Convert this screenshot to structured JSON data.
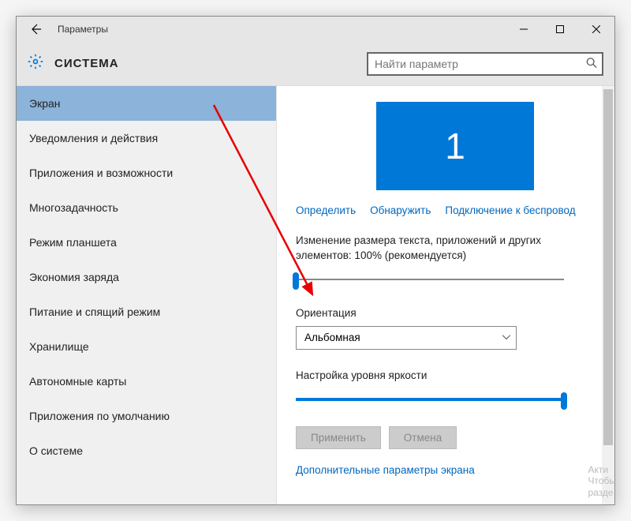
{
  "window": {
    "title": "Параметры"
  },
  "header": {
    "section": "СИСТЕМА",
    "search_placeholder": "Найти параметр"
  },
  "sidebar": {
    "items": [
      {
        "label": "Экран",
        "selected": true
      },
      {
        "label": "Уведомления и действия",
        "selected": false
      },
      {
        "label": "Приложения и возможности",
        "selected": false
      },
      {
        "label": "Многозадачность",
        "selected": false
      },
      {
        "label": "Режим планшета",
        "selected": false
      },
      {
        "label": "Экономия заряда",
        "selected": false
      },
      {
        "label": "Питание и спящий режим",
        "selected": false
      },
      {
        "label": "Хранилище",
        "selected": false
      },
      {
        "label": "Автономные карты",
        "selected": false
      },
      {
        "label": "Приложения по умолчанию",
        "selected": false
      },
      {
        "label": "О системе",
        "selected": false
      }
    ]
  },
  "content": {
    "monitor_number": "1",
    "links": {
      "identify": "Определить",
      "detect": "Обнаружить",
      "wireless": "Подключение к беспровод"
    },
    "scale_label": "Изменение размера текста, приложений и других элементов: 100% (рекомендуется)",
    "scale_slider": {
      "value": 0,
      "max": 100
    },
    "orientation_label": "Ориентация",
    "orientation_value": "Альбомная",
    "brightness_label": "Настройка уровня яркости",
    "brightness_slider": {
      "value": 100,
      "max": 100
    },
    "btn_apply": "Применить",
    "btn_cancel": "Отмена",
    "advanced_link": "Дополнительные параметры экрана"
  },
  "watermark": {
    "line1": "Акти",
    "line2": "Чтобы",
    "line3": "разде"
  },
  "colors": {
    "accent": "#0078d7",
    "link": "#0067c0"
  }
}
